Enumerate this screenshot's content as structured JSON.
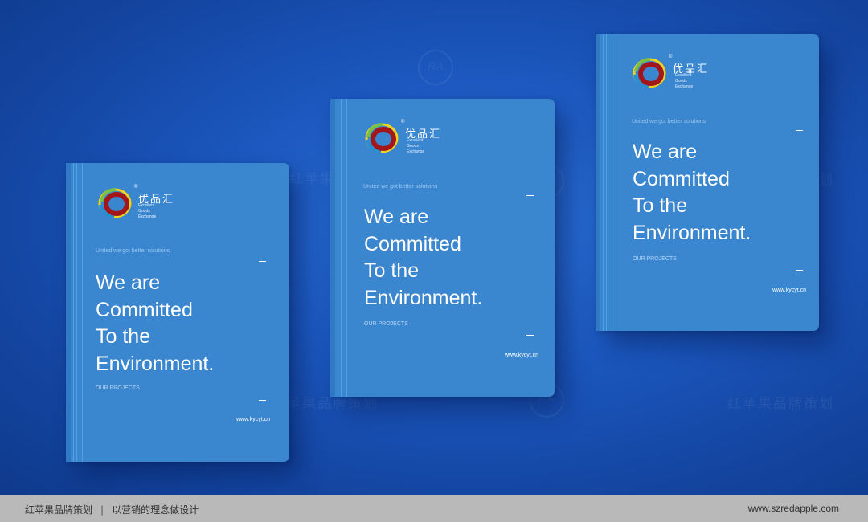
{
  "watermark": {
    "text": "红苹果品牌策划"
  },
  "books": [
    {
      "brand": {
        "cn": "优品汇",
        "reg": "®",
        "en_line1": "Excellent",
        "en_line2": "Goods",
        "en_line3": "Exchange"
      },
      "tagline": "United we got better solutions",
      "headline": [
        "We are",
        "Committed",
        "To the",
        "Environment."
      ],
      "projects": "OUR PROJECTS",
      "url": "www.kycyt.cn"
    },
    {
      "brand": {
        "cn": "优品汇",
        "reg": "®",
        "en_line1": "Excellent",
        "en_line2": "Goods",
        "en_line3": "Exchange"
      },
      "tagline": "United we got better solutions",
      "headline": [
        "We are",
        "Committed",
        "To the",
        "Environment."
      ],
      "projects": "OUR PROJECTS",
      "url": "www.kycyt.cn"
    },
    {
      "brand": {
        "cn": "优品汇",
        "reg": "®",
        "en_line1": "Excellent",
        "en_line2": "Goods",
        "en_line3": "Exchange"
      },
      "tagline": "United we got better solutions",
      "headline": [
        "We are",
        "Committed",
        "To the",
        "Environment."
      ],
      "projects": "OUR PROJECTS",
      "url": "www.kycyt.cn"
    }
  ],
  "footer": {
    "brand": "红苹果品牌策划",
    "separator": "|",
    "slogan": "以营销的理念做设计",
    "website": "www.szredapple.com"
  },
  "colors": {
    "background": "#1c58bf",
    "book_cover": "#3a86cf",
    "footer_bar": "#b9b9b9"
  }
}
